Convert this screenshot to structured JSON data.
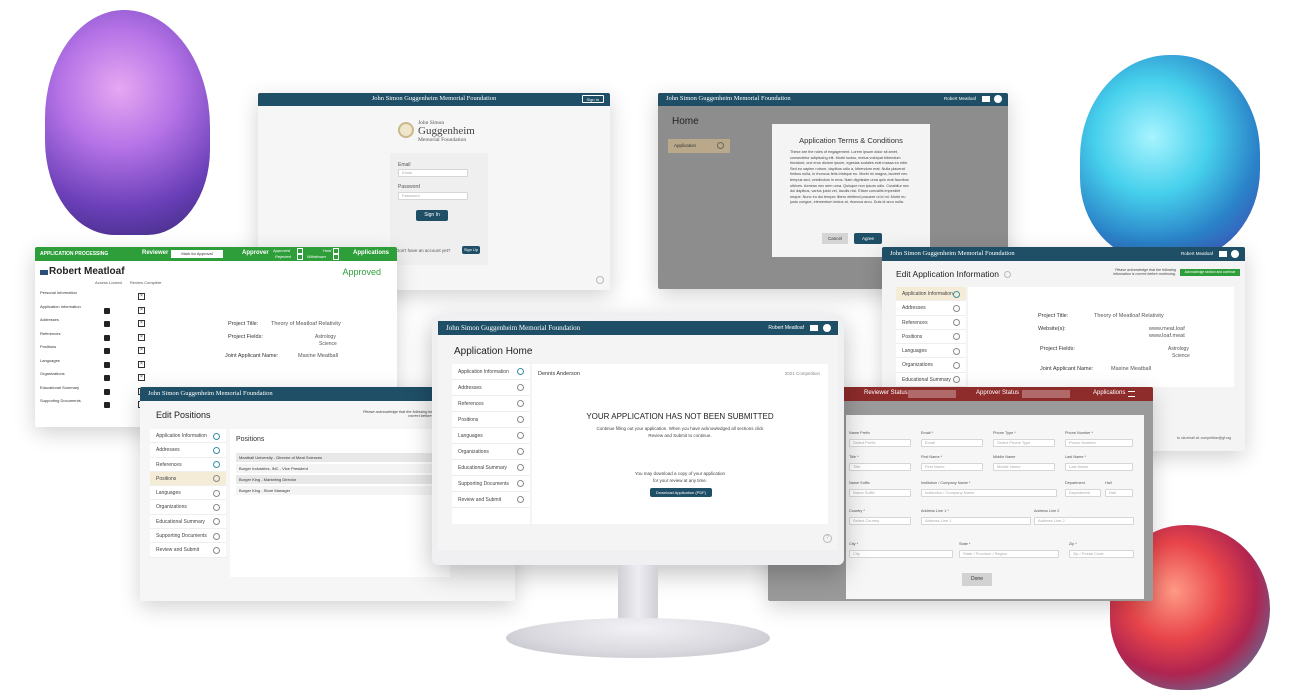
{
  "foundation_name": "John Simon Guggenheim Memorial Foundation",
  "login": {
    "signin_top": "Sign In",
    "logo_line1": "John Simon",
    "logo_line2": "Guggenheim",
    "logo_line3": "Memorial Foundation",
    "email_label": "Email",
    "email_placeholder": "Email",
    "password_label": "Password",
    "password_placeholder": "Password",
    "signin_button": "Sign In",
    "no_account": "Don't have an account yet?",
    "signup_button": "Sign Up"
  },
  "terms": {
    "user": "Robert Meatloaf",
    "home_title": "Home",
    "app_item": "Application",
    "modal_title": "Application Terms & Conditions",
    "modal_body": "These are the rules of engagement. Lorem ipsum dolor sit amet, consectetur adipiscing elit. Morbi luctus, metus volutpat bibendum tincidunt, orci eros dictum ipsum, egestas sodales erat massa eu nibh. Sed eu sapien rutrum, dapibus odio a, bibendum erat. Nulla placerat finibus nulla, in rhoncus felis tristique eu. Morbi mi magna, laoreet nec tempus sed, vestibulum in eros. Nam dignissim urna quis erat faucibus ultrices. Aenean nec sem urna. Quisque non ipsum odio. Curabitur nec dui dapibus, varius justo vel, iaculis nisi. Etiam convallis imperdiet neque. Nunc eu dui tempor libero eleifend posuere ut id mi. Morbi eu justo congue, elementum lectus at, rhoncus arcu. Duis id arcu nulla.",
    "cancel": "Cancel",
    "agree": "Agree"
  },
  "processing": {
    "bar_title": "APPLICATION PROCESSING",
    "reviewer_label": "Reviewer",
    "mark_button": "Mark for Approval",
    "approver_label": "Approver",
    "approved": "Approved",
    "hold": "Hold",
    "rejected": "Rejected",
    "withdrawn": "Withdrawn",
    "applications": "Applications",
    "name": "Robert Meatloaf",
    "status": "Approved",
    "col_access": "Access Locked",
    "col_review": "Review Complete",
    "sections": [
      "Personal Information",
      "Application Information",
      "Addresses",
      "References",
      "Positions",
      "Languages",
      "Organizations",
      "Educational Summary",
      "Supporting Documents"
    ],
    "project_title_label": "Project Title:",
    "project_title_value": "Theory of Meatloaf Relativity",
    "project_fields_label": "Project Fields:",
    "project_fields_value1": "Astrology",
    "project_fields_value2": "Science",
    "joint_label": "Joint Applicant Name:",
    "joint_value": "Maxine Meatball"
  },
  "edit_info": {
    "user": "Robert Meatloaf",
    "title": "Edit Application Information",
    "notice": "Please acknowledge that the following information is correct before continuing.",
    "ack_button": "Acknowledge section and continue",
    "nav": [
      "Application Information",
      "Addresses",
      "References",
      "Positions",
      "Languages",
      "Organizations",
      "Educational Summary"
    ],
    "project_title_label": "Project Title:",
    "project_title_value": "Theory of Meatloaf Relativity",
    "websites_label": "Website(s):",
    "website1": "www.meat.loaf",
    "website2": "www.loaf.meat",
    "fields_label": "Project Fields:",
    "field1": "Astrology",
    "field2": "Science",
    "joint_label": "Joint Applicant Name:",
    "joint_value": "Maxine Meatball",
    "footer_email": "to via email at: competition@gf.org"
  },
  "edit_positions": {
    "title": "Edit Positions",
    "notice": "Please acknowledge that the following information is correct before continuing.",
    "nav": [
      "Application Information",
      "Addresses",
      "References",
      "Positions",
      "Languages",
      "Organizations",
      "Educational Summary",
      "Supporting Documents",
      "Review and Submit"
    ],
    "heading": "Positions",
    "rows": [
      "Meatball University - Director of Meat Sciences",
      "Burger Industries, INC - Vice President",
      "Burger King - Marketing Director",
      "Burger King - Store Manager"
    ]
  },
  "home": {
    "user": "Robert Meatloaf",
    "title": "Application Home",
    "nav": [
      "Application Information",
      "Addresses",
      "References",
      "Positions",
      "Languages",
      "Organizations",
      "Educational Summary",
      "Supporting Documents",
      "Review and Submit"
    ],
    "applicant": "Dennis Anderson",
    "competition": "2021 Competition",
    "headline": "YOUR APPLICATION HAS NOT BEEN SUBMITTED",
    "sub1": "Continue filling out your application.  When you have acknowledged all sections click",
    "sub2": "Review and Submit to continue.",
    "download1": "You may download a copy of your application",
    "download2": "for your review at any time.",
    "download_button": "Download Application (PDF)",
    "help": "?"
  },
  "form": {
    "reviewer_status": "Reviewer Status",
    "approver_status": "Approver Status",
    "applications": "Applications",
    "labels": {
      "name_prefix": "Name Prefix",
      "email": "Email *",
      "phone_type": "Phone Type *",
      "phone_number": "Phone Number *",
      "title": "Title *",
      "first_name": "First Name *",
      "middle_name": "Middle Name",
      "last_name": "Last Name *",
      "name_suffix": "Name Suffix",
      "institution": "Institution / Company Name *",
      "department": "Department",
      "hall": "Hall",
      "country": "Country *",
      "address1": "Address Line 1 *",
      "address2": "Address Line 2",
      "city": "City *",
      "state": "State *",
      "zip": "Zip *"
    },
    "placeholders": {
      "name_prefix": "Select Prefix",
      "email": "Email",
      "phone_type": "Select Phone Type",
      "phone_number": "Phone Number",
      "title": "Title",
      "first_name": "First Name",
      "middle_name": "Middle Name",
      "last_name": "Last Name",
      "name_suffix": "Name Suffix",
      "institution": "Institution / Company Name",
      "department": "Department",
      "hall": "Hall",
      "country": "Select Country",
      "address1": "Address Line 1",
      "address2": "Address Line 2",
      "city": "City",
      "state": "State / Province / Region",
      "zip": "Zip / Postal Code"
    },
    "done": "Done"
  },
  "colors": {
    "navy": "#1e4f66",
    "green": "#2e9e3a",
    "red": "#8e2b2b"
  },
  "icons": [
    "envelope-icon",
    "user-icon",
    "lock-icon",
    "checkbox-icon",
    "check-circle-icon",
    "hamburger-menu-icon",
    "help-icon",
    "chevron-down-icon"
  ]
}
